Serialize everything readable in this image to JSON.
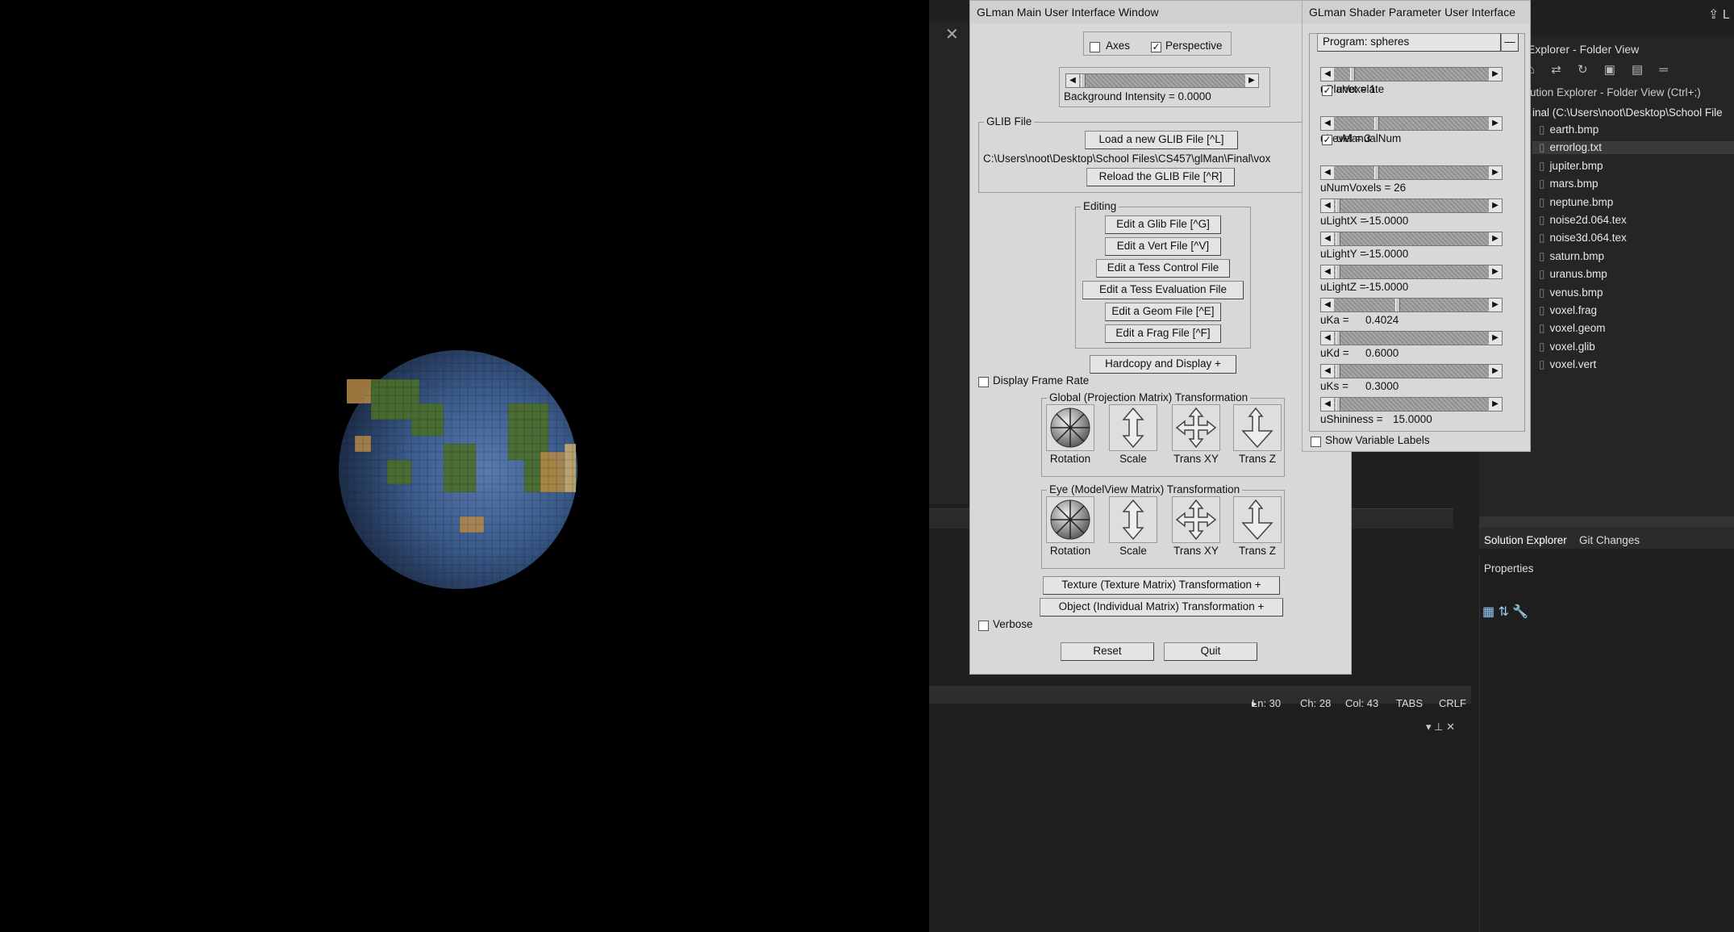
{
  "main_window": {
    "title": "GLman Main User Interface Window",
    "axes_label": "Axes",
    "axes_checked": false,
    "perspective_label": "Perspective",
    "perspective_checked": true,
    "background_intensity": "Background Intensity = 0.0000",
    "glib_group": "GLIB File",
    "load_glib": "Load a new GLIB File [^L]",
    "glib_path": "C:\\Users\\noot\\Desktop\\School Files\\CS457\\glMan\\Final\\vox",
    "reload_glib": "Reload the GLIB File [^R]",
    "editing_group": "Editing",
    "edit_buttons": [
      "Edit a Glib File [^G]",
      "Edit a Vert File [^V]",
      "Edit a Tess Control File",
      "Edit a Tess Evaluation File",
      "Edit a Geom File [^E]",
      "Edit a Frag File [^F]"
    ],
    "hardcopy": "Hardcopy and Display +",
    "display_frame_rate": "Display Frame Rate",
    "global_group": "Global (Projection Matrix) Transformation",
    "eye_group": "Eye (ModelView Matrix) Transformation",
    "transform_labels": [
      "Rotation",
      "Scale",
      "Trans XY",
      "Trans Z"
    ],
    "texture_transform": "Texture (Texture Matrix) Transformation +",
    "object_transform": "Object (Individual Matrix) Transformation +",
    "verbose": "Verbose",
    "reset": "Reset",
    "quit": "Quit"
  },
  "shader_window": {
    "title": "GLman Shader Parameter User Interface",
    "program": "Program: spheres",
    "program_toggle": "—",
    "params": [
      {
        "label": "uPlanet = 1",
        "value_fraction": 0.1
      },
      {
        "label": "uVoxelate",
        "checkbox": true
      },
      {
        "label": "uLevel = 3",
        "value_fraction": 0.26
      },
      {
        "label": "uManualNum",
        "checkbox": true
      },
      {
        "label": "uNumVoxels = 26",
        "value_fraction": 0.26
      },
      {
        "label": "uLightX =",
        "value": "-15.0000",
        "value_fraction": 0.0
      },
      {
        "label": "uLightY =",
        "value": "-15.0000",
        "value_fraction": 0.0
      },
      {
        "label": "uLightZ =",
        "value": "-15.0000",
        "value_fraction": 0.0
      },
      {
        "label": "uKa =",
        "value": "0.4024",
        "value_fraction": 0.4
      },
      {
        "label": "uKd =",
        "value": "0.6000",
        "value_fraction": 0.0
      },
      {
        "label": "uKs =",
        "value": "0.3000",
        "value_fraction": 0.0
      },
      {
        "label": "uShininess =",
        "value": "15.0000",
        "value_fraction": 0.0
      }
    ],
    "show_labels": "Show Variable Labels"
  },
  "vs": {
    "explorer_title": "Explorer - Folder View",
    "search": "lution Explorer - Folder View (Ctrl+;)",
    "root": "inal (C:\\Users\\noot\\Desktop\\School File",
    "files": [
      "earth.bmp",
      "errorlog.txt",
      "jupiter.bmp",
      "mars.bmp",
      "neptune.bmp",
      "noise2d.064.tex",
      "noise3d.064.tex",
      "saturn.bmp",
      "uranus.bmp",
      "venus.bmp",
      "voxel.frag",
      "voxel.geom",
      "voxel.glib",
      "voxel.vert"
    ],
    "selected_file": "errorlog.txt",
    "tab_solution": "Solution Explorer",
    "tab_git": "Git Changes",
    "properties": "Properties",
    "status": {
      "ln": "Ln: 30",
      "ch": "Ch: 28",
      "col": "Col: 43",
      "tabs": "TABS",
      "crlf": "CRLF"
    },
    "corner": "L"
  }
}
